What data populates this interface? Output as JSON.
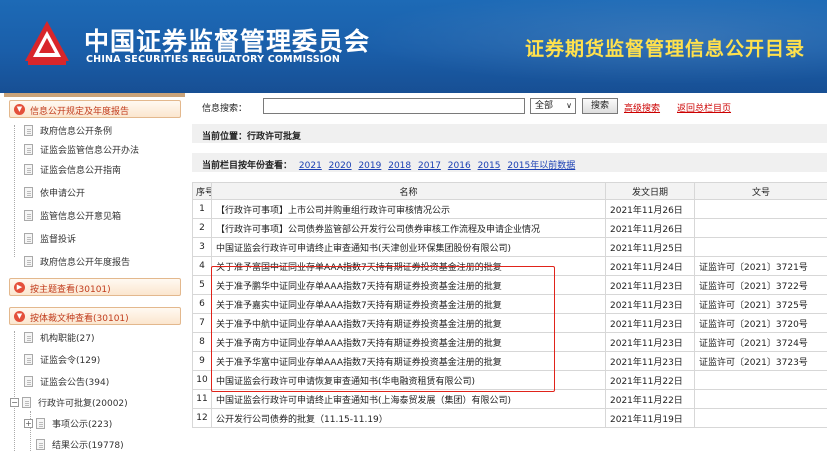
{
  "header": {
    "cn_title": "中国证券监督管理委员会",
    "en_title": "CHINA SECURITIES REGULATORY COMMISSION",
    "site_title": "证券期货监督管理信息公开目录",
    "brand_color": "#1a5ea9",
    "accent_color": "#ffe14d"
  },
  "sidebar": {
    "group1": {
      "label": "信息公开规定及年度报告",
      "icon": "expanded-dot-icon"
    },
    "group1_items": [
      "政府信息公开条例",
      "证监会监管信息公开办法",
      "证监会信息公开指南",
      "依申请公开",
      "监管信息公开意见箱",
      "监督投诉",
      "政府信息公开年度报告"
    ],
    "group2": {
      "label": "按主题查看(30101)"
    },
    "group3": {
      "label": "按体裁文种查看(30101)"
    },
    "group3_items": [
      "机构职能(27)",
      "证监会令(129)",
      "证监会公告(394)"
    ],
    "tree_node": {
      "label": "行政许可批复(20002)"
    },
    "tree_children": [
      "事项公示(223)",
      "结果公示(19778)"
    ]
  },
  "search": {
    "label": "信息搜索：",
    "value": "",
    "scope": "全部",
    "button": "搜索",
    "advanced_link": "高级搜索",
    "back_link": "返回总栏目页"
  },
  "location": "当前位置：行政许可批复",
  "years_bar": {
    "label": "当前栏目按年份查看：",
    "years": [
      "2021",
      "2020",
      "2019",
      "2018",
      "2017",
      "2016",
      "2015",
      "2015年以前数据"
    ]
  },
  "table": {
    "headers": [
      "序号",
      "名称",
      "发文日期",
      "文号"
    ],
    "rows": [
      {
        "no": "1",
        "name": "【行政许可事项】上市公司并购重组行政许可审核情况公示",
        "date": "2021年11月26日",
        "doc_no": ""
      },
      {
        "no": "2",
        "name": "【行政许可事项】公司债券监管部公开发行公司债券审核工作流程及申请企业情况",
        "date": "2021年11月26日",
        "doc_no": ""
      },
      {
        "no": "3",
        "name": "中国证监会行政许可申请终止审查通知书(天津创业环保集团股份有限公司)",
        "date": "2021年11月25日",
        "doc_no": ""
      },
      {
        "no": "4",
        "name": "关于准予富国中证同业存单AAA指数7天持有期证券投资基金注册的批复",
        "date": "2021年11月24日",
        "doc_no": "证监许可〔2021〕3721号"
      },
      {
        "no": "5",
        "name": "关于准予鹏华中证同业存单AAA指数7天持有期证券投资基金注册的批复",
        "date": "2021年11月23日",
        "doc_no": "证监许可〔2021〕3722号"
      },
      {
        "no": "6",
        "name": "关于准予嘉实中证同业存单AAA指数7天持有期证券投资基金注册的批复",
        "date": "2021年11月23日",
        "doc_no": "证监许可〔2021〕3725号"
      },
      {
        "no": "7",
        "name": "关于准予中航中证同业存单AAA指数7天持有期证券投资基金注册的批复",
        "date": "2021年11月23日",
        "doc_no": "证监许可〔2021〕3720号"
      },
      {
        "no": "8",
        "name": "关于准予南方中证同业存单AAA指数7天持有期证券投资基金注册的批复",
        "date": "2021年11月23日",
        "doc_no": "证监许可〔2021〕3724号"
      },
      {
        "no": "9",
        "name": "关于准予华富中证同业存单AAA指数7天持有期证券投资基金注册的批复",
        "date": "2021年11月23日",
        "doc_no": "证监许可〔2021〕3723号"
      },
      {
        "no": "10",
        "name": "中国证监会行政许可申请恢复审查通知书(华电融资租赁有限公司)",
        "date": "2021年11月22日",
        "doc_no": ""
      },
      {
        "no": "11",
        "name": "中国证监会行政许可申请终止审查通知书(上海泰贸发展（集团）有限公司)",
        "date": "2021年11月22日",
        "doc_no": ""
      },
      {
        "no": "12",
        "name": "公开发行公司债券的批复（11.15-11.19）",
        "date": "2021年11月19日",
        "doc_no": ""
      }
    ],
    "highlight_color": "#e0231a"
  }
}
